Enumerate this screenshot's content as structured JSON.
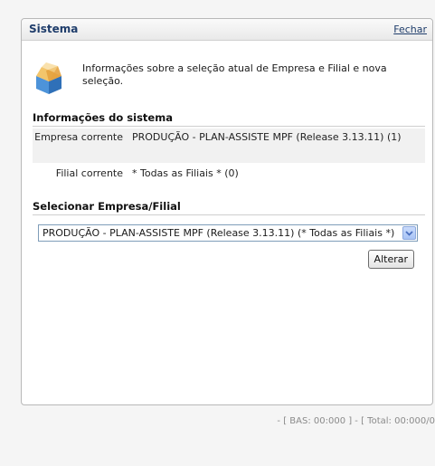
{
  "panel": {
    "title": "Sistema",
    "close_label": "Fechar",
    "intro_text": "Informações sobre a seleção atual de Empresa e Filial e  nova seleção.",
    "icon": "open-box-icon"
  },
  "system_info": {
    "title": "Informações do sistema",
    "rows": [
      {
        "label": "Empresa corrente",
        "value": "PRODUÇÃO - PLAN-ASSISTE MPF (Release 3.13.11) (1)"
      },
      {
        "label": "Filial corrente",
        "value": "* Todas as Filiais * (0)"
      }
    ]
  },
  "selection": {
    "title": "Selecionar Empresa/Filial",
    "selected_value": "PRODUÇÃO - PLAN-ASSISTE MPF (Release 3.13.11) (* Todas as Filiais *)",
    "button_label": "Alterar"
  },
  "footer": {
    "status": "- [ BAS: 00:000 ] - [ Total: 00:000/0"
  },
  "colors": {
    "title": "#1f3d6b",
    "arrow_accent": "#4a6fbf"
  }
}
